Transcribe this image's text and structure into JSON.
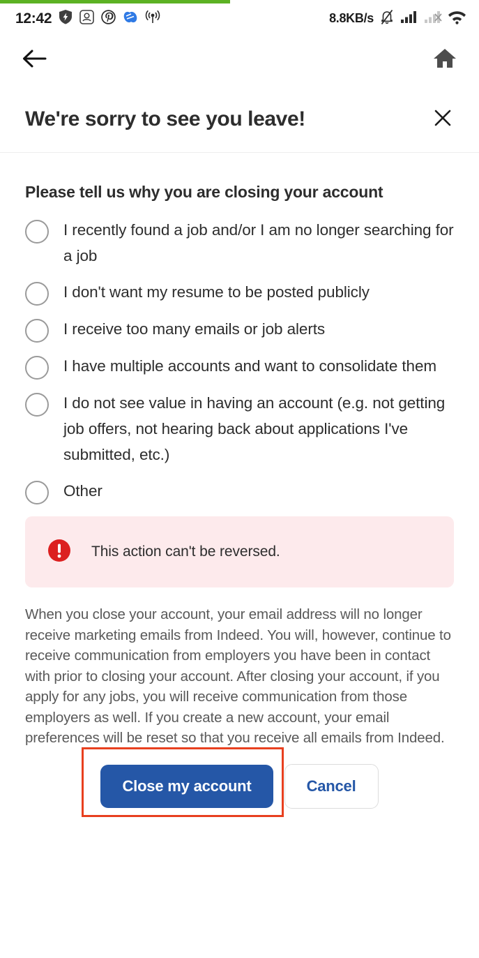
{
  "browser": {
    "progress_percent": 48,
    "progress_color": "#5cb223"
  },
  "status_bar": {
    "clock": "12:42",
    "network_speed": "8.8KB/s",
    "left_icons": [
      "shield-icon",
      "app-badge-icon",
      "pinterest-icon",
      "blue-app-icon",
      "broadcast-icon"
    ],
    "right_icons": [
      "notifications-silenced-icon",
      "signal-bars-full-icon",
      "signal-bars-off-icon",
      "wifi-icon"
    ]
  },
  "top_bar": {
    "back_icon": "arrow-left-icon",
    "home_icon": "home-icon"
  },
  "modal": {
    "title": "We're sorry to see you leave!",
    "close_icon": "close-icon"
  },
  "form": {
    "heading": "Please tell us why you are closing your account",
    "options": [
      {
        "label": "I recently found a job and/or I am no longer searching for a job",
        "selected": false
      },
      {
        "label": "I don't want my resume to be posted publicly",
        "selected": false
      },
      {
        "label": "I receive too many emails or job alerts",
        "selected": false
      },
      {
        "label": "I have multiple accounts and want to consolidate them",
        "selected": false
      },
      {
        "label": "I do not see value in having an account (e.g. not getting job offers, not hearing back about applications I've submitted, etc.)",
        "selected": false
      },
      {
        "label": "Other",
        "selected": false
      }
    ]
  },
  "warning": {
    "icon": "exclamation-circle-icon",
    "text": "This action can't be reversed.",
    "background_color": "#fdeaec",
    "icon_color": "#dc2020"
  },
  "disclaimer": {
    "text": "When you close your account, your email address will no longer receive marketing emails from Indeed. You will, however, continue to receive communication from employers you have been in contact with prior to closing your account. After closing your account, if you apply for any jobs, you will receive communication from those employers as well. If you create a new account, your email preferences will be reset so that you receive all emails from Indeed."
  },
  "actions": {
    "primary_label": "Close my account",
    "secondary_label": "Cancel",
    "primary_color": "#2557a7",
    "highlight_color": "#e8401f"
  }
}
